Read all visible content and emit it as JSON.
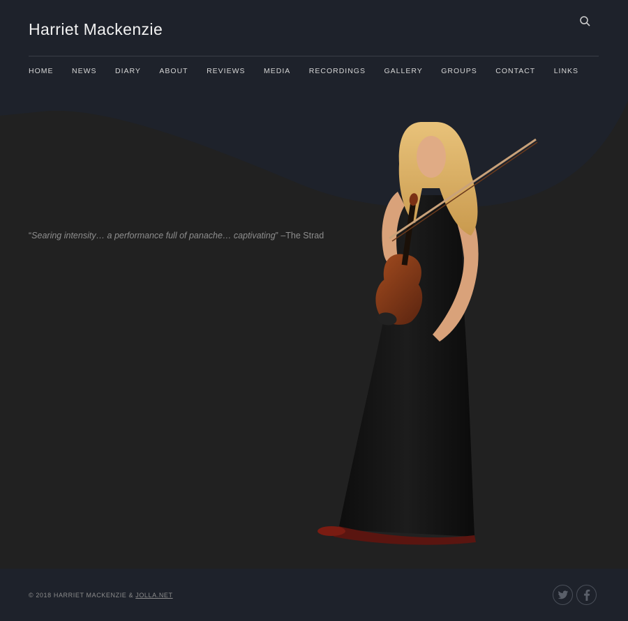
{
  "site": {
    "title": "Harriet Mackenzie"
  },
  "search": {
    "icon": "search-icon"
  },
  "nav": {
    "items": [
      {
        "label": "HOME"
      },
      {
        "label": "NEWS"
      },
      {
        "label": "DIARY"
      },
      {
        "label": "ABOUT"
      },
      {
        "label": "REVIEWS"
      },
      {
        "label": "MEDIA"
      },
      {
        "label": "RECORDINGS"
      },
      {
        "label": "GALLERY"
      },
      {
        "label": "GROUPS"
      },
      {
        "label": "CONTACT"
      },
      {
        "label": "LINKS"
      }
    ]
  },
  "quote": {
    "open": "“",
    "text": "Searing intensity… a performance full of panache… captivating",
    "close": "”",
    "attribution": " –The Strad"
  },
  "footer": {
    "copyright": "© 2018 HARRIET MACKENZIE & ",
    "link": "JOLLA.NET",
    "social": [
      {
        "icon": "twitter-icon"
      },
      {
        "icon": "facebook-icon"
      }
    ]
  },
  "colors": {
    "header_bg": "#1e222b",
    "body_bg": "#212121",
    "footer_bg": "#1e222b"
  }
}
